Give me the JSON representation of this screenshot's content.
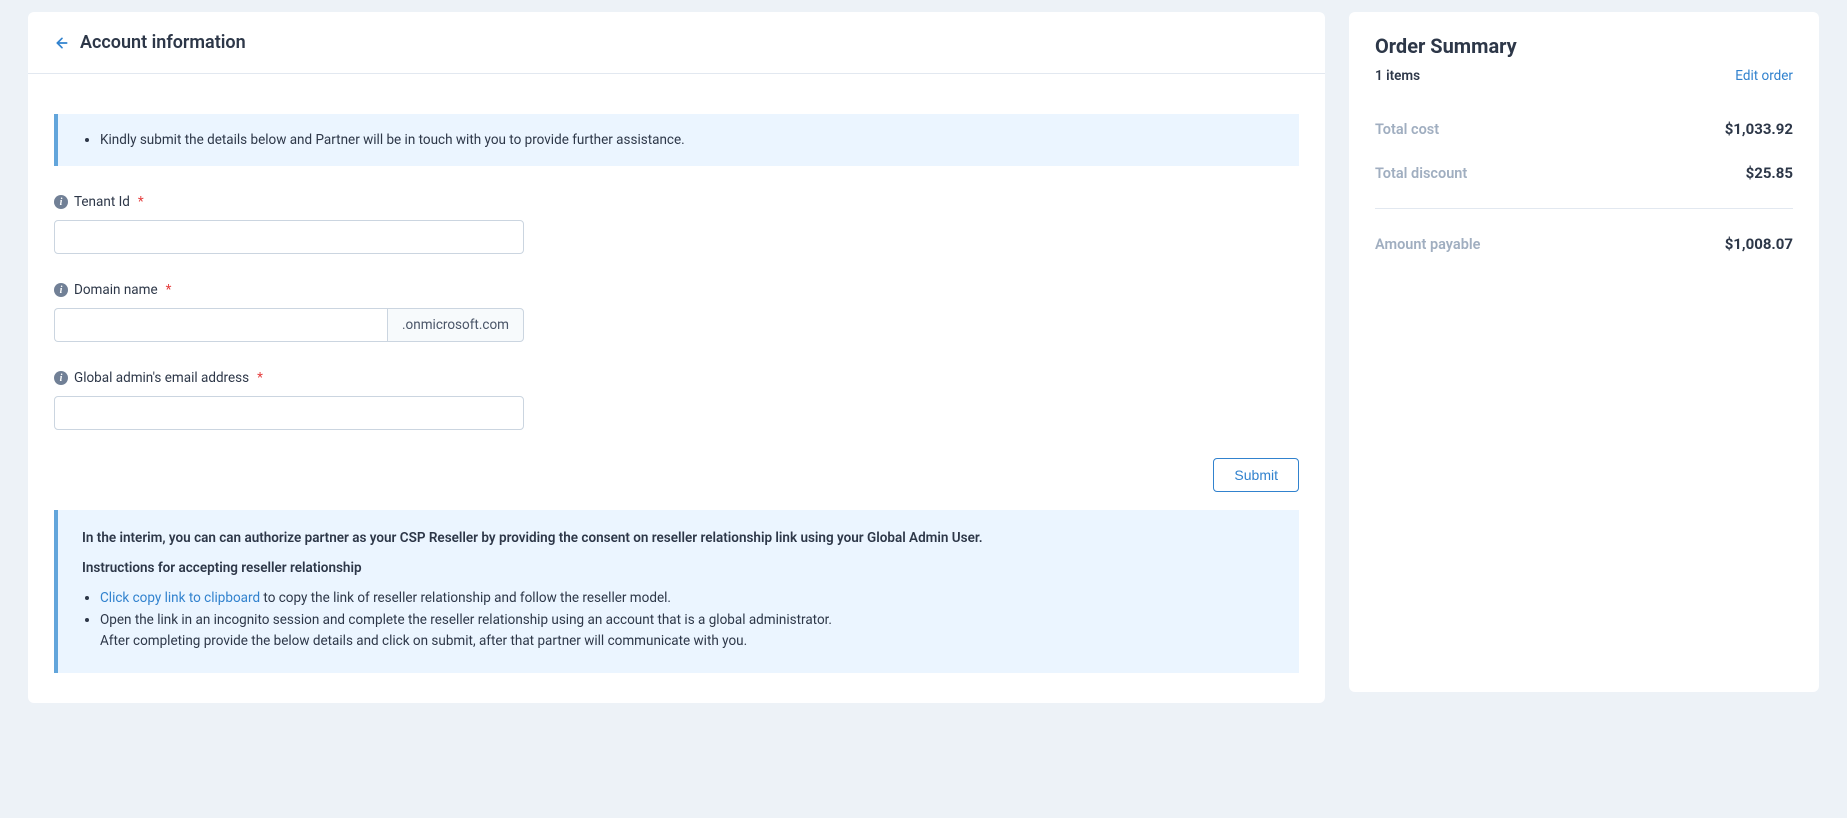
{
  "header": {
    "title": "Account information"
  },
  "banner": {
    "text": "Kindly submit the details below and Partner will be in touch with you to provide further assistance."
  },
  "form": {
    "tenant": {
      "label": "Tenant Id",
      "value": ""
    },
    "domain": {
      "label": "Domain name",
      "value": "",
      "suffix": ".onmicrosoft.com"
    },
    "adminEmail": {
      "label": "Global admin's email address",
      "value": ""
    },
    "submitLabel": "Submit"
  },
  "instructions": {
    "intro": "In the interim, you can can authorize partner as your CSP Reseller by providing the consent on reseller relationship link using your Global Admin User.",
    "subheader": "Instructions for accepting reseller relationship",
    "copyLinkText": "Click copy link to clipboard",
    "copyLinkRest": " to copy the link of reseller relationship and follow the reseller model.",
    "step2a": "Open the link in an incognito session and complete the reseller relationship using an account that is a global administrator.",
    "step2b": "After completing provide the below details and click on submit, after that partner will communicate with you."
  },
  "summary": {
    "title": "Order Summary",
    "itemsCount": "1 items",
    "editLabel": "Edit order",
    "totalCostLabel": "Total cost",
    "totalCostValue": "$1,033.92",
    "totalDiscountLabel": "Total discount",
    "totalDiscountValue": "$25.85",
    "amountPayableLabel": "Amount payable",
    "amountPayableValue": "$1,008.07"
  }
}
